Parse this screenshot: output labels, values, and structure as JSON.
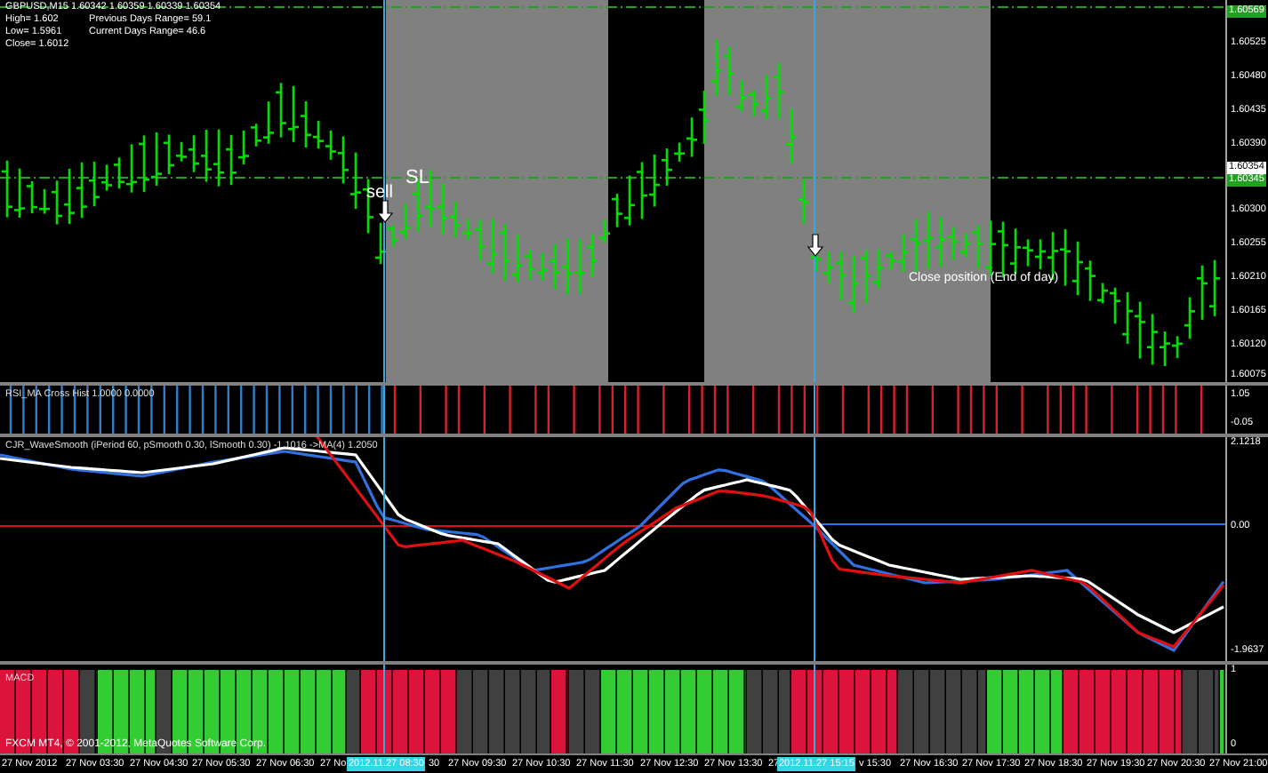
{
  "main_chart": {
    "info": [
      "GBPUSD,M15  1.60342 1.60359 1.60339 1.60354",
      "High= 1.602",
      "Previous Days Range= 59.1",
      "Low= 1.5961",
      "Current Days Range= 46.6",
      "Close= 1.6012"
    ],
    "annotations": [
      {
        "kind": "label",
        "text": "sell"
      },
      {
        "kind": "label",
        "text": "SL"
      },
      {
        "kind": "arrow"
      },
      {
        "kind": "arrow"
      },
      {
        "kind": "label",
        "text": "Close position (End of day)"
      }
    ],
    "price_axis": [
      {
        "kind": "line",
        "label": "1.60569"
      },
      {
        "kind": "tick",
        "label": "1.60525"
      },
      {
        "kind": "tick",
        "label": "1.60480"
      },
      {
        "kind": "tick",
        "label": "1.60435"
      },
      {
        "kind": "tick",
        "label": "1.60390"
      },
      {
        "kind": "bid",
        "label": "1.60354"
      },
      {
        "kind": "line",
        "label": "1.60345"
      },
      {
        "kind": "tick",
        "label": "1.60300"
      },
      {
        "kind": "tick",
        "label": "1.60255"
      },
      {
        "kind": "tick",
        "label": "1.60210"
      },
      {
        "kind": "tick",
        "label": "1.60165"
      },
      {
        "kind": "tick",
        "label": "1.60120"
      },
      {
        "kind": "tick",
        "label": "1.60075"
      }
    ]
  },
  "rsi_panel": {
    "title": "RSI_MA Cross Hist 1.0000 0.0000",
    "axis": [
      "1.05",
      "-0.05"
    ]
  },
  "wave_panel": {
    "title": "CJR_WaveSmooth (iPeriod 60, pSmooth 0.30, lSmooth 0.30) -1.1016 ->MA(4) 1.2050",
    "axis": [
      "2.1218",
      "0.00",
      "-1.9637"
    ]
  },
  "macd_panel": {
    "title": "MACD",
    "axis": [
      "1",
      "0"
    ],
    "footer": "FXCM MT4, © 2001-2012, MetaQuotes Software Corp."
  },
  "time_axis": [
    {
      "text": "27 Nov 2012",
      "highlighted": false
    },
    {
      "text": "27 Nov 03:30",
      "highlighted": false
    },
    {
      "text": "27 Nov 04:30",
      "highlighted": false
    },
    {
      "text": "27 Nov 05:30",
      "highlighted": false
    },
    {
      "text": "27 Nov 06:30",
      "highlighted": false
    },
    {
      "text": "27 No",
      "highlighted": false
    },
    {
      "text": "2012.11.27 08:30",
      "highlighted": true
    },
    {
      "text": "30",
      "highlighted": false
    },
    {
      "text": "27 Nov 09:30",
      "highlighted": false
    },
    {
      "text": "27 Nov 10:30",
      "highlighted": false
    },
    {
      "text": "27 Nov 11:30",
      "highlighted": false
    },
    {
      "text": "27 Nov 12:30",
      "highlighted": false
    },
    {
      "text": "27 Nov 13:30",
      "highlighted": false
    },
    {
      "text": "27",
      "highlighted": false
    },
    {
      "text": "2012.11.27 15:15",
      "highlighted": true
    },
    {
      "text": "v 15:30",
      "highlighted": false
    },
    {
      "text": "27 Nov 16:30",
      "highlighted": false
    },
    {
      "text": "27 Nov 17:30",
      "highlighted": false
    },
    {
      "text": "27 Nov 18:30",
      "highlighted": false
    },
    {
      "text": "27 Nov 19:30",
      "highlighted": false
    },
    {
      "text": "27 Nov 20:30",
      "highlighted": false
    },
    {
      "text": "27 Nov 21:00",
      "highlighted": false
    }
  ]
}
